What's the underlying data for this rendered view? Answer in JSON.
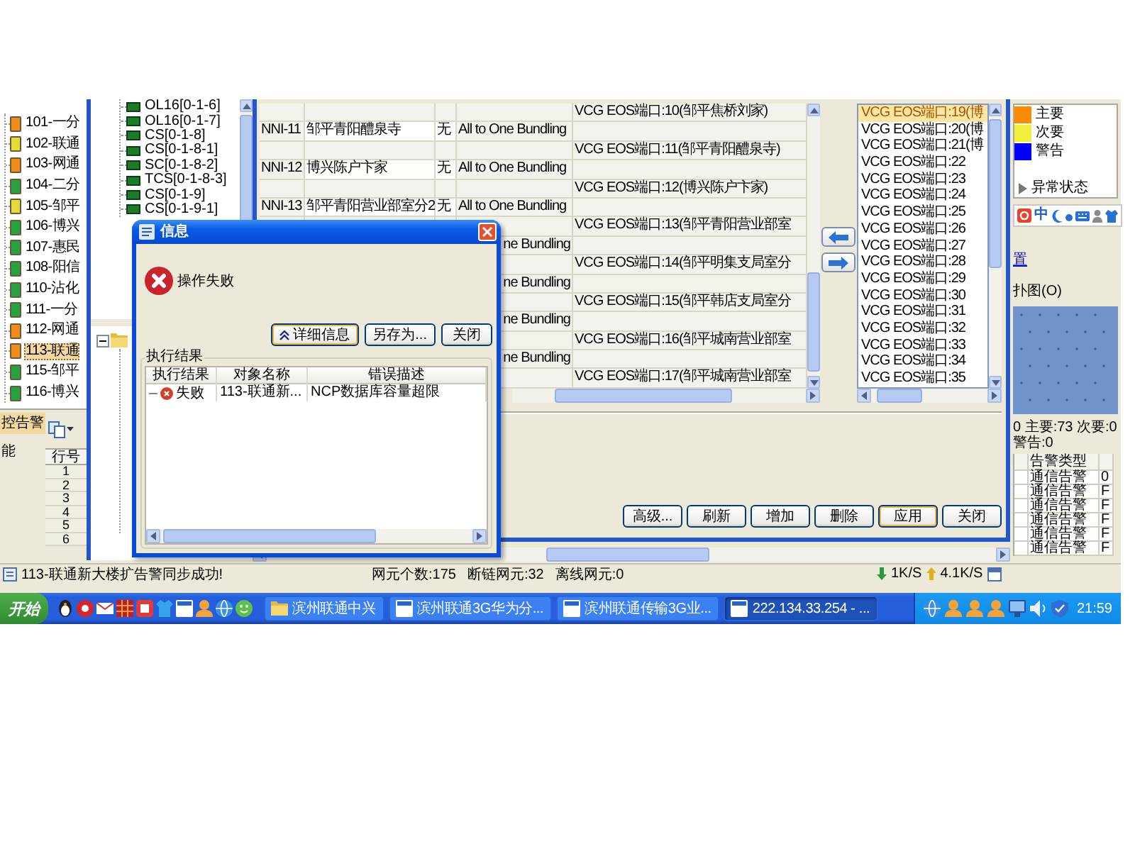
{
  "tree": {
    "items": [
      {
        "label": "101-一分",
        "color": "#f08c1c",
        "selected": false
      },
      {
        "label": "102-联通",
        "color": "#e3dc3a",
        "selected": false
      },
      {
        "label": "103-网通",
        "color": "#f08c1c",
        "selected": false
      },
      {
        "label": "104-二分",
        "color": "#27a243",
        "selected": false
      },
      {
        "label": "105-邹平",
        "color": "#e3dc3a",
        "selected": false
      },
      {
        "label": "106-博兴",
        "color": "#27a243",
        "selected": false
      },
      {
        "label": "107-惠民",
        "color": "#27a243",
        "selected": false
      },
      {
        "label": "108-阳信",
        "color": "#27a243",
        "selected": false
      },
      {
        "label": "110-沾化",
        "color": "#27a243",
        "selected": false
      },
      {
        "label": "111-一分",
        "color": "#27a243",
        "selected": false
      },
      {
        "label": "112-网通",
        "color": "#f08c1c",
        "selected": false
      },
      {
        "label": "113-联通",
        "color": "#f08c1c",
        "selected": true
      },
      {
        "label": "115-邹平",
        "color": "#27a243",
        "selected": false
      },
      {
        "label": "116-博兴",
        "color": "#27a243",
        "selected": false
      }
    ]
  },
  "side_tabs": [
    {
      "label": "控告警",
      "selected": true
    },
    {
      "label": "能",
      "selected": false
    }
  ],
  "row_table": {
    "column": "行号",
    "rows": [
      "1",
      "2",
      "3",
      "4",
      "5",
      "6"
    ]
  },
  "board_tree": {
    "items": [
      "OL16[0-1-6]",
      "OL16[0-1-7]",
      "CS[0-1-8]",
      "CS[0-1-8-1]",
      "SC[0-1-8-2]",
      "TCS[0-1-8-3]",
      "CS[0-1-9]",
      "CS[0-1-9-1]"
    ]
  },
  "bundle_table": {
    "rows": [
      {
        "kind": "port",
        "port": "VCG EOS端口:10(邹平焦桥刘家)"
      },
      {
        "kind": "nni",
        "cells": [
          "NNI-11",
          "邹平青阳醴泉寺",
          "无",
          "All to One Bundling"
        ]
      },
      {
        "kind": "port",
        "port": "VCG EOS端口:11(邹平青阳醴泉寺)"
      },
      {
        "kind": "nni",
        "cells": [
          "NNI-12",
          "博兴陈户卞家",
          "无",
          "All to One Bundling"
        ]
      },
      {
        "kind": "port",
        "port": "VCG EOS端口:12(博兴陈户卞家)"
      },
      {
        "kind": "nni",
        "cells": [
          "NNI-13",
          "邹平青阳营业部室分2",
          "无",
          "All to One Bundling"
        ]
      },
      {
        "kind": "port",
        "port": "VCG EOS端口:13(邹平青阳营业部室"
      },
      {
        "kind": "peek",
        "text": "ne Bundling"
      },
      {
        "kind": "port",
        "port": "VCG EOS端口:14(邹平明集支局室分"
      },
      {
        "kind": "peek",
        "text": "ne Bundling"
      },
      {
        "kind": "port",
        "port": "VCG EOS端口:15(邹平韩店支局室分"
      },
      {
        "kind": "peek",
        "text": "ne Bundling"
      },
      {
        "kind": "port",
        "port": "VCG EOS端口:16(邹平城南营业部室"
      },
      {
        "kind": "peek",
        "text": "ne Bundling"
      },
      {
        "kind": "port",
        "port": "VCG EOS端口:17(邹平城南营业部室"
      }
    ]
  },
  "port_list": {
    "items": [
      {
        "label": "VCG EOS端口:19(博",
        "selected": true
      },
      {
        "label": "VCG EOS端口:20(博",
        "selected": false
      },
      {
        "label": "VCG EOS端口:21(博",
        "selected": false
      },
      {
        "label": "VCG EOS端口:22",
        "selected": false
      },
      {
        "label": "VCG EOS端口:23",
        "selected": false
      },
      {
        "label": "VCG EOS端口:24",
        "selected": false
      },
      {
        "label": "VCG EOS端口:25",
        "selected": false
      },
      {
        "label": "VCG EOS端口:26",
        "selected": false
      },
      {
        "label": "VCG EOS端口:27",
        "selected": false
      },
      {
        "label": "VCG EOS端口:28",
        "selected": false
      },
      {
        "label": "VCG EOS端口:29",
        "selected": false
      },
      {
        "label": "VCG EOS端口:30",
        "selected": false
      },
      {
        "label": "VCG EOS端口:31",
        "selected": false
      },
      {
        "label": "VCG EOS端口:32",
        "selected": false
      },
      {
        "label": "VCG EOS端口:33",
        "selected": false
      },
      {
        "label": "VCG EOS端口:34",
        "selected": false
      },
      {
        "label": "VCG EOS端口:35",
        "selected": false
      }
    ]
  },
  "window_buttons": [
    {
      "label": "高级...",
      "default": false
    },
    {
      "label": "刷新",
      "default": false
    },
    {
      "label": "增加",
      "default": false
    },
    {
      "label": "删除",
      "default": false
    },
    {
      "label": "应用",
      "default": true
    },
    {
      "label": "关闭",
      "default": false
    }
  ],
  "legend": {
    "items": [
      {
        "kind": "swatch",
        "label": "主要",
        "color": "#ff8c00"
      },
      {
        "kind": "swatch",
        "label": "次要",
        "color": "#f2ee3c"
      },
      {
        "kind": "swatch",
        "label": "警告",
        "color": "#0000ff"
      },
      {
        "kind": "status",
        "label": "异常状态"
      }
    ]
  },
  "ime_bar": {
    "mode": "中"
  },
  "side_links": [
    {
      "kind": "link",
      "label": "置"
    },
    {
      "kind": "menu",
      "label": "扑图(O)"
    }
  ],
  "alarm_summary": "0 主要:73 次要:0 警告:0",
  "alarm_table": {
    "columns": [
      "告警类型"
    ],
    "rows": [
      {
        "type": "通信告警",
        "column_3": "0"
      },
      {
        "type": "通信告警",
        "column_3": "F"
      },
      {
        "type": "通信告警",
        "column_3": "F"
      },
      {
        "type": "通信告警",
        "column_3": "F"
      },
      {
        "type": "通信告警",
        "column_3": "F"
      },
      {
        "type": "通信告警",
        "column_3": "F"
      }
    ]
  },
  "info_dialog": {
    "title": "信息",
    "message": "操作失败",
    "buttons": [
      {
        "label": "详细信息",
        "kind": "expand",
        "default": true
      },
      {
        "label": "另存为...",
        "kind": "plain",
        "default": false
      },
      {
        "label": "关闭",
        "kind": "plain",
        "default": false
      }
    ],
    "group": "执行结果",
    "columns": [
      "执行结果",
      "对象名称",
      "错误描述"
    ],
    "rows": [
      {
        "result": "失败",
        "object": "113-联通新...",
        "error": "NCP数据库容量超限"
      }
    ]
  },
  "status_bar": {
    "message": "113-联通新大楼扩告警同步成功!",
    "counts": [
      "网元个数:175",
      "断链网元:32",
      "离线网元:0"
    ],
    "download": "1K/S",
    "upload": "4.1K/S"
  },
  "taskbar": {
    "start": "开始",
    "tasks": [
      {
        "label": "滨州联通中兴",
        "selected": false
      },
      {
        "label": "滨州联通3G华为分...",
        "selected": false
      },
      {
        "label": "滨州联通传输3G业...",
        "selected": false
      },
      {
        "label": "222.134.33.254 - ...",
        "selected": true
      }
    ],
    "clock": "21:59"
  }
}
